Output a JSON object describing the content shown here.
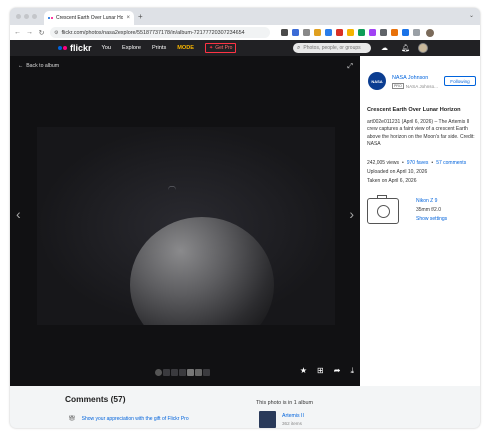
{
  "browser": {
    "tab_title": "Crescent Earth Over Lunar Horizon",
    "tab_close": "×",
    "new_tab": "+",
    "url": "flickr.com/photos/nasa2explore/55187737178/in/album-72177720307234654",
    "back": "←",
    "forward": "→",
    "reload": "↻"
  },
  "flickr_header": {
    "logo_text": "flickr",
    "nav": [
      "You",
      "Explore",
      "Prints",
      "MODE"
    ],
    "get_pro": "Get Pro",
    "search_placeholder": "Photos, people, or groups"
  },
  "viewer": {
    "back_label": "Back to album",
    "prev_arrow": "‹",
    "next_arrow": "›"
  },
  "sidebar": {
    "owner_name": "NASA Johnson",
    "owner_badge": "PRO",
    "owner_sub": "NASA Johnso...",
    "follow_label": "Following",
    "photo_title": "Crescent Earth Over Lunar Horizon",
    "description": "art002e011231 (April 6, 2026) – The Artemis II crew captures a faint view of a crescent Earth above the horizon on the Moon's far side. Credit: NASA",
    "views": "242,005 views",
    "faves": "970 faves",
    "comments": "57 comments",
    "uploaded": "Uploaded on April 10, 2026",
    "taken": "Taken on April 6, 2026",
    "camera": "Nikon Z 9",
    "lens": "35mm f/2.0",
    "show_settings": "Show settings"
  },
  "lower": {
    "comments_heading": "Comments (57)",
    "pro_gift": "Show your appreciation with the gift of Flickr Pro",
    "album_heading": "This photo is in 1 album",
    "album_name": "Artemis II",
    "album_count": "362 items"
  },
  "colors": {
    "flickr_blue": "#0063dc",
    "flickr_pink": "#ff0084",
    "mode_yellow": "#f7b500",
    "header_bg": "#212124"
  }
}
